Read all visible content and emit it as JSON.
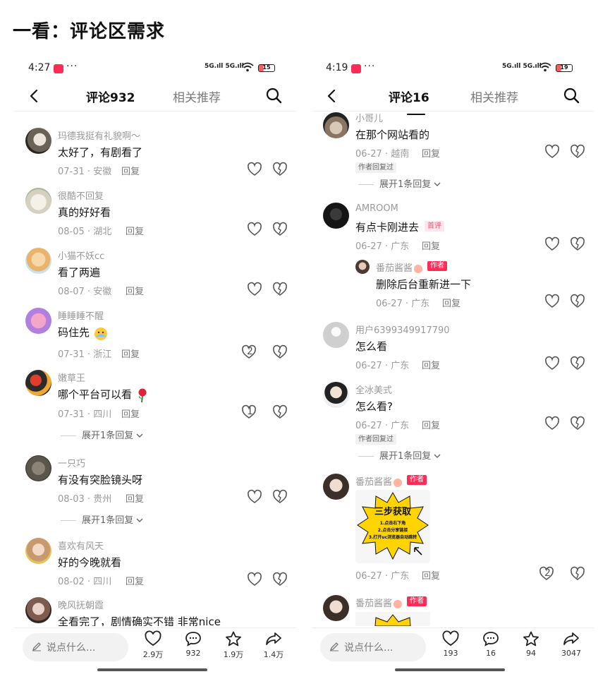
{
  "heading": "一看：评论区需求",
  "colors": {
    "author_badge": "#ff2c55",
    "first_badge_bg": "#ffe6ec",
    "promo_yellow": "#ffd400"
  },
  "phones": [
    {
      "status": {
        "time": "4:27",
        "dots": "···",
        "signal": "5G.ıll 5G.ıll",
        "battery": "15"
      },
      "nav": {
        "tab_comments": "评论932",
        "tab_related": "相关推荐"
      },
      "comments": [
        {
          "user": "玛德我挺有礼貌啊～",
          "text": "太好了，有剧看了",
          "date": "07-31",
          "region": "安徽",
          "reply": "回复",
          "likes": ""
        },
        {
          "user": "很酷不回复",
          "text": "真的好好看",
          "date": "08-05",
          "region": "湖北",
          "reply": "回复",
          "likes": ""
        },
        {
          "user": "小猫不妖cc",
          "text": "看了两遍",
          "date": "08-07",
          "region": "安徽",
          "reply": "回复",
          "likes": ""
        },
        {
          "user": "睡睡睡不醒",
          "text": "码住先",
          "date": "07-31",
          "region": "浙江",
          "reply": "回复",
          "likes": "2"
        },
        {
          "user": "嫩草王",
          "text": "哪个平台可以看",
          "date": "07-31",
          "region": "四川",
          "reply": "回复",
          "likes": "1",
          "expand": "展开1条回复"
        },
        {
          "user": "一只巧",
          "text": "有没有突脸镜头呀",
          "date": "08-03",
          "region": "贵州",
          "reply": "回复",
          "likes": "",
          "expand": "展开1条回复"
        },
        {
          "user": "喜欢有风天",
          "text": "好的今晚就看",
          "date": "08-02",
          "region": "四川",
          "reply": "回复",
          "likes": ""
        },
        {
          "user": "晚风抚朝霞",
          "text": "全看完了，剧情确实不错 非常nice"
        }
      ],
      "bottom": {
        "placeholder": "说点什么...",
        "like_count": "2.9万",
        "comment_count": "932",
        "fav_count": "1.9万",
        "share_count": "1.4万"
      }
    },
    {
      "status": {
        "time": "4:19",
        "dots": "···",
        "signal": "5G.ıll 5G.ıll",
        "battery": "19"
      },
      "nav": {
        "tab_comments": "评论16",
        "tab_related": "相关推荐"
      },
      "comments": [
        {
          "user": "小哥儿",
          "text": "在那个网站看的",
          "date": "06-27",
          "region": "越南",
          "reply": "回复",
          "badge": "作者回复过",
          "expand": "展开1条回复"
        },
        {
          "user": "AMROOM",
          "text": "有点卡刚进去",
          "date": "06-27",
          "region": "广东",
          "reply": "回复",
          "first_badge": "首评"
        },
        {
          "user": "番茄酱酱",
          "text": "删除后台重新进一下",
          "date": "06-27",
          "region": "广东",
          "reply": "回复",
          "author_badge": "作者"
        },
        {
          "user": "用户6399349917790",
          "text": "怎么看",
          "date": "06-27",
          "region": "广东",
          "reply": "回复"
        },
        {
          "user": "全冰美式",
          "text": "怎么看?",
          "date": "06-27",
          "region": "广东",
          "reply": "回复",
          "badge": "作者回复过",
          "expand": "展开1条回复"
        },
        {
          "user": "番茄酱酱",
          "author_badge": "作者",
          "date": "06-27",
          "region": "广东",
          "reply": "回复",
          "likes": "2",
          "promo": {
            "title": "三步获取",
            "line1": "1.点击右下角",
            "line2": "2.点击分享链接",
            "line3": "3.打开uc浏览器自动跳转"
          }
        },
        {
          "user": "番茄酱酱",
          "author_badge": "作者"
        }
      ],
      "bottom": {
        "placeholder": "说点什么...",
        "like_count": "193",
        "comment_count": "16",
        "fav_count": "94",
        "share_count": "3047"
      }
    }
  ]
}
